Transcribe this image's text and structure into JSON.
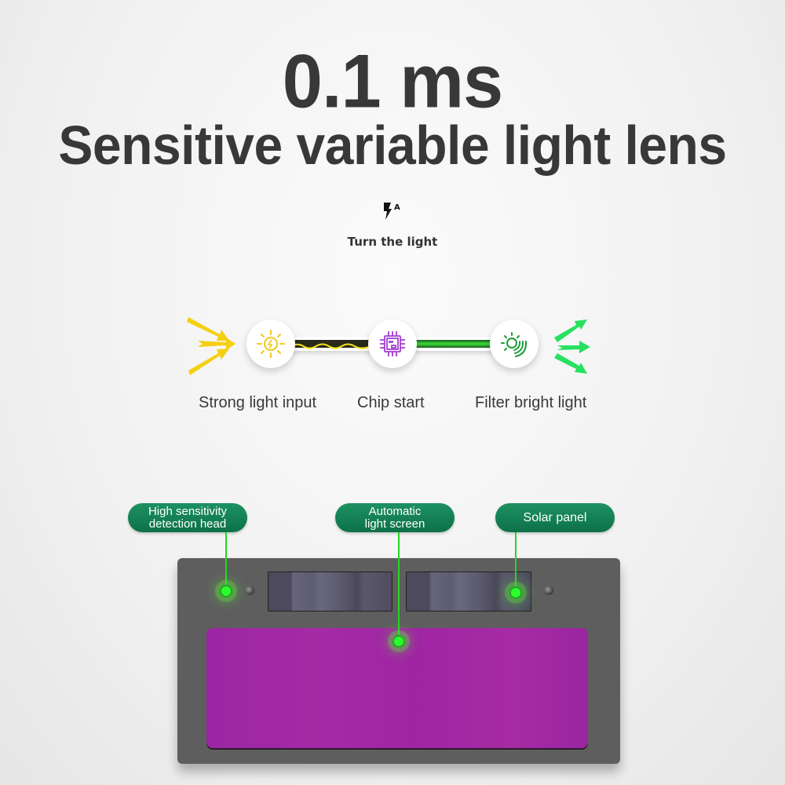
{
  "header": {
    "headline": "0.1 ms",
    "subheadline": "Sensitive variable light lens",
    "mode_icon": "auto-flash-icon",
    "mode_label": "Turn the light"
  },
  "flow": {
    "steps": [
      {
        "label": "Strong light input",
        "icon": "sun-bolt-icon",
        "color": "#f2c81a"
      },
      {
        "label": "Chip start",
        "icon": "chip-icon",
        "color": "#a23fd1"
      },
      {
        "label": "Filter bright light",
        "icon": "sun-filter-icon",
        "color": "#1e9c3a"
      }
    ],
    "input_arrows_color": "#f5cf12",
    "output_arrows_color": "#27e060",
    "tube_left_color": "#f0dd1a",
    "tube_right_color": "#2ed42a"
  },
  "lens": {
    "callouts": [
      {
        "line1": "High sensitivity",
        "line2": "detection head"
      },
      {
        "line1": "Automatic",
        "line2": "light screen"
      },
      {
        "line1": "Solar panel",
        "line2": ""
      }
    ],
    "frame_color": "#5e5e5e",
    "screen_color": "#a127a5",
    "hotspot_color": "#2bff2b",
    "callout_color": "#148055"
  }
}
